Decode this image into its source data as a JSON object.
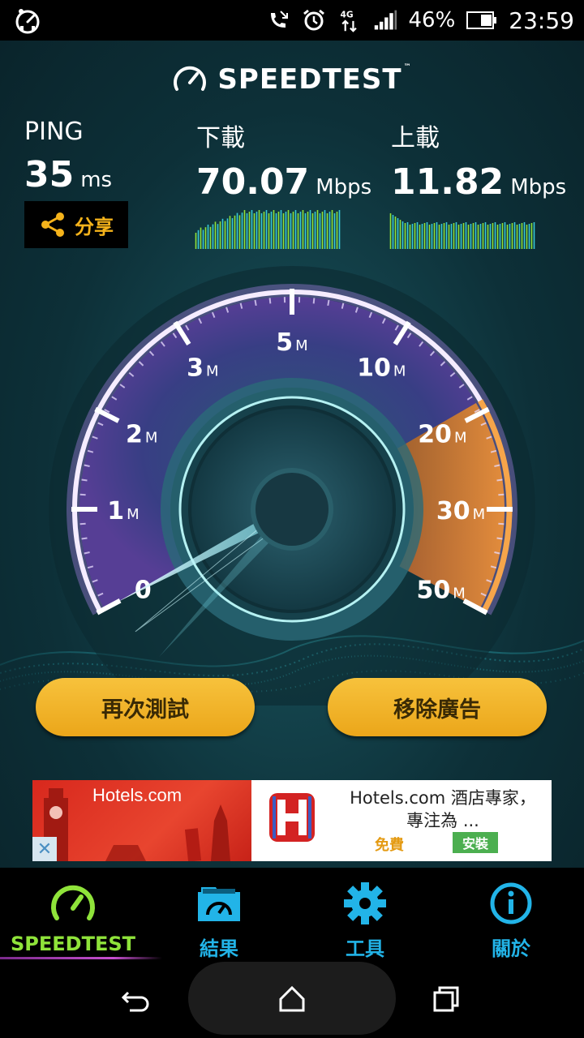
{
  "status_bar": {
    "battery_percent": "46%",
    "time": "23:59",
    "network": "4G",
    "icons": [
      "app-gauge-icon",
      "missed-call-icon",
      "alarm-icon",
      "network-4g-icon",
      "signal-icon",
      "battery-icon"
    ]
  },
  "app": {
    "logo_text": "SPEEDTEST",
    "logo_tm": "™"
  },
  "results": {
    "ping": {
      "label": "PING",
      "value": "35",
      "unit": "ms"
    },
    "download": {
      "label": "下載",
      "value": "70.07",
      "unit": "Mbps"
    },
    "upload": {
      "label": "上載",
      "value": "11.82",
      "unit": "Mbps"
    }
  },
  "share_button": {
    "label": "分享",
    "icon": "share-icon"
  },
  "gauge": {
    "scale_labels": [
      {
        "num": "0",
        "unit": ""
      },
      {
        "num": "1",
        "unit": "M"
      },
      {
        "num": "2",
        "unit": "M"
      },
      {
        "num": "3",
        "unit": "M"
      },
      {
        "num": "5",
        "unit": "M"
      },
      {
        "num": "10",
        "unit": "M"
      },
      {
        "num": "20",
        "unit": "M"
      },
      {
        "num": "30",
        "unit": "M"
      },
      {
        "num": "50",
        "unit": "M"
      }
    ],
    "needle_value": "0"
  },
  "buttons": {
    "retest": "再次測試",
    "remove_ads": "移除廣告"
  },
  "ad": {
    "brand": "Hotels.com",
    "title_line1": "Hotels.com 酒店專家，",
    "title_line2": "專注為 ...",
    "free_label": "免費",
    "install_label": "安裝",
    "close_glyph": "✕"
  },
  "bottom_nav": [
    {
      "label": "SPEEDTEST",
      "icon": "speedometer-icon",
      "active": true
    },
    {
      "label": "結果",
      "icon": "results-folder-icon",
      "active": false
    },
    {
      "label": "工具",
      "icon": "gear-icon",
      "active": false
    },
    {
      "label": "關於",
      "icon": "info-icon",
      "active": false
    }
  ],
  "colors": {
    "accent_gold": "#f5b31b",
    "nav_active": "#8fe33a",
    "nav_inactive": "#22b4e8",
    "gauge_high": "#f08a2a",
    "gauge_ring": "#d9b8ff"
  }
}
